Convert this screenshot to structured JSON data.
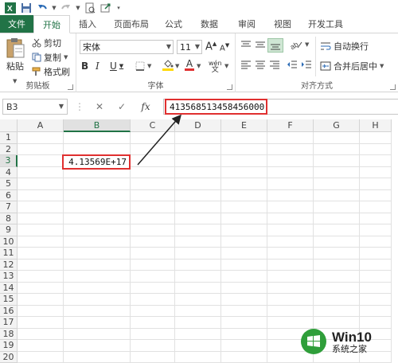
{
  "quick_access": {
    "icons": [
      "excel-app-icon",
      "save-icon",
      "undo-icon",
      "undo-dropdown-icon",
      "redo-icon",
      "redo-dropdown-icon",
      "print-preview-icon",
      "share-icon",
      "customize-qat-icon"
    ]
  },
  "tabs": [
    "文件",
    "开始",
    "插入",
    "页面布局",
    "公式",
    "数据",
    "审阅",
    "视图",
    "开发工具"
  ],
  "active_tab": "开始",
  "ribbon": {
    "clipboard": {
      "paste_label": "粘贴",
      "cut_label": "剪切",
      "copy_label": "复制",
      "format_painter_label": "格式刷",
      "group_label": "剪贴板"
    },
    "font": {
      "font_name": "宋体",
      "font_size": "11",
      "bold": "B",
      "italic": "I",
      "underline": "U",
      "font_color_letter": "A",
      "phonetic_label": "wén",
      "group_label": "字体",
      "font_color": "#e03030",
      "fill_color": "#ffd800"
    },
    "alignment": {
      "wrap_text_label": "自动换行",
      "merge_center_label": "合并后居中",
      "group_label": "对齐方式"
    }
  },
  "formula_bar": {
    "name_box": "B3",
    "fx_label": "fx",
    "value": "413568513458456000"
  },
  "sheet": {
    "columns": [
      "A",
      "B",
      "C",
      "D",
      "E",
      "F",
      "G",
      "H"
    ],
    "rows": [
      "1",
      "2",
      "3",
      "4",
      "5",
      "6",
      "7",
      "8",
      "9",
      "10",
      "11",
      "12",
      "13",
      "14",
      "15",
      "16",
      "17",
      "18",
      "19",
      "20"
    ],
    "selected_column": "B",
    "selected_row": "3",
    "active_cell_display": "4.13569E+17"
  },
  "watermark": {
    "brand": "Win10",
    "site": "系统之家"
  },
  "colors": {
    "excel_green": "#217346",
    "highlight_red": "#e03030"
  }
}
